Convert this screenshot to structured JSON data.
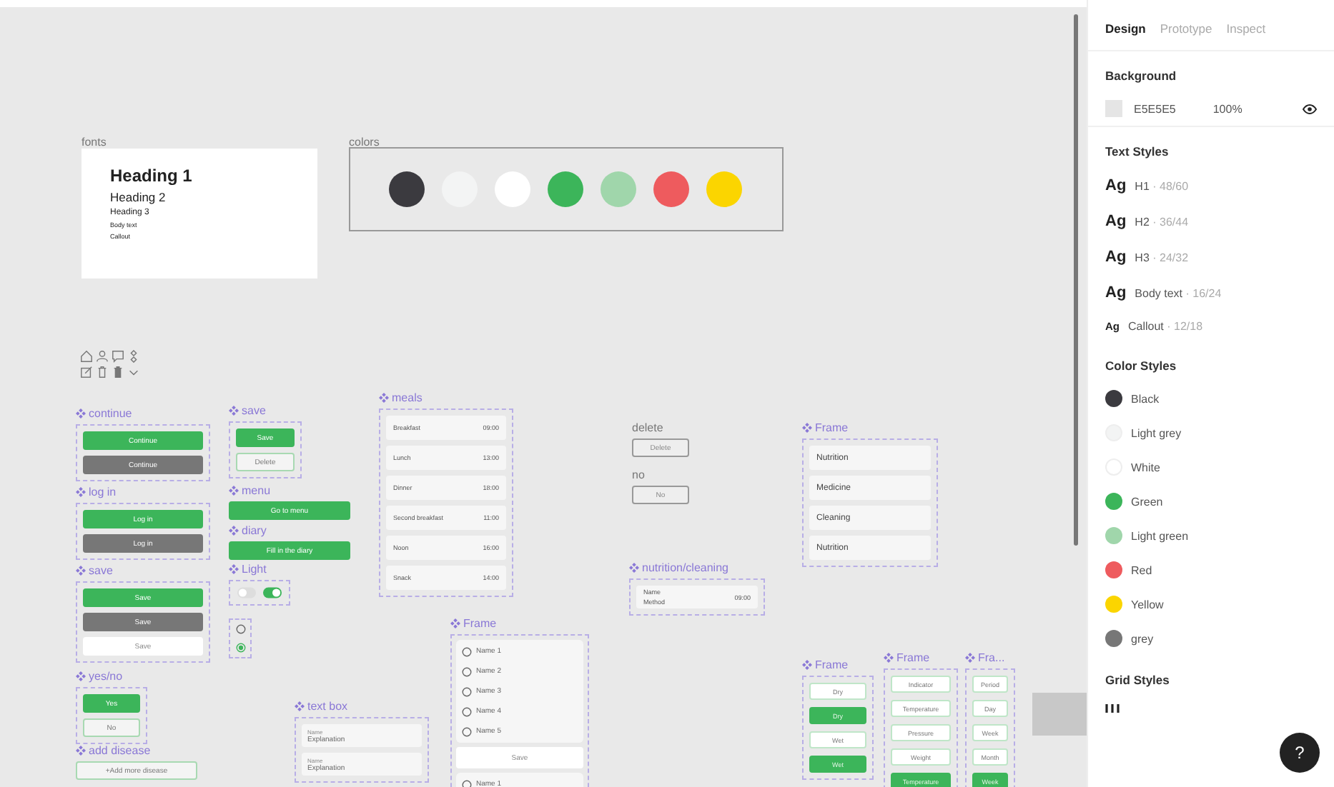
{
  "canvas": {
    "fonts": {
      "label": "fonts",
      "samples": [
        "Heading 1",
        "Heading 2",
        "Heading 3",
        "Body text",
        "Callout"
      ]
    },
    "colors": {
      "label": "colors",
      "swatches": [
        {
          "color": "#3b3a3f"
        },
        {
          "color": "#f3f4f4"
        },
        {
          "color": "#ffffff"
        },
        {
          "color": "#3cb55a"
        },
        {
          "color": "#a0d6ab"
        },
        {
          "color": "#ee5b5e"
        },
        {
          "color": "#fbd500"
        }
      ]
    },
    "components": [
      {
        "kind": "buttons",
        "title": "continue",
        "component": true,
        "framed": true,
        "buttons": [
          {
            "label": "Continue",
            "kind": "green"
          },
          {
            "label": "Continue",
            "kind": "grey"
          }
        ]
      },
      {
        "kind": "buttons",
        "title": "log in",
        "component": true,
        "framed": true,
        "buttons": [
          {
            "label": "Log in",
            "kind": "green"
          },
          {
            "label": "Log in",
            "kind": "grey"
          }
        ]
      },
      {
        "kind": "buttons",
        "title": "save",
        "component": true,
        "framed": true,
        "buttons": [
          {
            "label": "Save",
            "kind": "green"
          },
          {
            "label": "Save",
            "kind": "grey"
          },
          {
            "label": "Save",
            "kind": "white"
          }
        ]
      },
      {
        "kind": "buttons",
        "title": "yes/no",
        "component": true,
        "framed": true,
        "buttons": [
          {
            "label": "Yes",
            "kind": "green"
          },
          {
            "label": "No",
            "kind": "outline"
          }
        ]
      },
      {
        "kind": "buttons",
        "title": "add disease",
        "component": true,
        "framed": false,
        "buttons": [
          {
            "label": "+Add more disease",
            "kind": "outline"
          }
        ]
      },
      {
        "kind": "buttons",
        "title": "save",
        "component": true,
        "framed": true,
        "buttons": [
          {
            "label": "Save",
            "kind": "green"
          },
          {
            "label": "Delete",
            "kind": "outline"
          }
        ]
      },
      {
        "kind": "buttons",
        "title": "menu",
        "component": true,
        "framed": false,
        "buttons": [
          {
            "label": "Go to menu",
            "kind": "green"
          }
        ]
      },
      {
        "kind": "buttons",
        "title": "diary",
        "component": true,
        "framed": false,
        "buttons": [
          {
            "label": "Fill in the diary",
            "kind": "green"
          }
        ]
      },
      {
        "kind": "switches",
        "title": "Light",
        "component": true,
        "switches": [
          {
            "on": false
          },
          {
            "on": true
          }
        ]
      },
      {
        "kind": "radios",
        "radios": [
          {
            "selected": false
          },
          {
            "selected": true
          }
        ]
      },
      {
        "kind": "meals",
        "title": "meals",
        "component": true,
        "rows": [
          {
            "name": "Breakfast",
            "time": "09:00"
          },
          {
            "name": "Lunch",
            "time": "13:00"
          },
          {
            "name": "Dinner",
            "time": "18:00"
          },
          {
            "name": "Second breakfast",
            "time": "11:00"
          },
          {
            "name": "Noon",
            "time": "16:00"
          },
          {
            "name": "Snack",
            "time": "14:00"
          }
        ]
      },
      {
        "kind": "fields",
        "title": "text box",
        "component": true,
        "fields": [
          {
            "label": "Name",
            "value": "Explanation"
          },
          {
            "label": "Name",
            "value": "Explanation"
          }
        ]
      },
      {
        "kind": "radio_list",
        "title": "Frame",
        "component": true,
        "options": [
          {
            "label": "Name 1",
            "selected": false
          },
          {
            "label": "Name 2",
            "selected": false
          },
          {
            "label": "Name 3",
            "selected": false
          },
          {
            "label": "Name 4",
            "selected": false
          },
          {
            "label": "Name 5",
            "selected": false
          }
        ],
        "action": "Save",
        "more_options": [
          {
            "label": "Name 1",
            "selected": false
          }
        ]
      },
      {
        "kind": "buttons",
        "title": "delete",
        "component": false,
        "framed": false,
        "buttons": [
          {
            "label": "Delete",
            "kind": "bordered"
          }
        ]
      },
      {
        "kind": "buttons",
        "title": "no",
        "component": false,
        "framed": false,
        "buttons": [
          {
            "label": "No",
            "kind": "bordered"
          }
        ]
      },
      {
        "kind": "info",
        "title": "nutrition/cleaning",
        "component": true,
        "name": "Name",
        "method": "Method",
        "time": "09:00"
      },
      {
        "kind": "list",
        "title": "Frame",
        "component": true,
        "items": [
          "Nutrition",
          "Medicine",
          "Cleaning",
          "Nutrition"
        ]
      },
      {
        "kind": "chips",
        "title": "Frame",
        "component": true,
        "chips": [
          {
            "label": "Dry",
            "selected": false
          },
          {
            "label": "Dry",
            "selected": true
          },
          {
            "label": "Wet",
            "selected": false
          },
          {
            "label": "Wet",
            "selected": true
          }
        ]
      },
      {
        "kind": "chips",
        "title": "Frame",
        "component": true,
        "chips": [
          {
            "label": "Indicator",
            "selected": false
          },
          {
            "label": "Temperature",
            "selected": false
          },
          {
            "label": "Pressure",
            "selected": false
          },
          {
            "label": "Weight",
            "selected": false
          },
          {
            "label": "Temperature",
            "selected": true
          }
        ]
      },
      {
        "kind": "chips",
        "title": "Fra...",
        "component": true,
        "chips": [
          {
            "label": "Period",
            "selected": false
          },
          {
            "label": "Day",
            "selected": false
          },
          {
            "label": "Week",
            "selected": false
          },
          {
            "label": "Month",
            "selected": false
          },
          {
            "label": "Week",
            "selected": true
          }
        ]
      }
    ]
  },
  "panel": {
    "tabs": [
      {
        "label": "Design",
        "selected": true
      },
      {
        "label": "Prototype",
        "selected": false
      },
      {
        "label": "Inspect",
        "selected": false
      }
    ],
    "background": {
      "title": "Background",
      "hex": "E5E5E5",
      "opacity": "100%"
    },
    "text_styles": {
      "title": "Text Styles",
      "items": [
        {
          "sample": "Ag",
          "name": "H1",
          "spec": " · 48/60",
          "kind": "large"
        },
        {
          "sample": "Ag",
          "name": "H2",
          "spec": " · 36/44",
          "kind": "large"
        },
        {
          "sample": "Ag",
          "name": "H3",
          "spec": " · 24/32",
          "kind": "large"
        },
        {
          "sample": "Ag",
          "name": "Body text",
          "spec": " · 16/24",
          "kind": "large"
        },
        {
          "sample": "Ag",
          "name": "Callout",
          "spec": " · 12/18",
          "kind": "small"
        }
      ]
    },
    "color_styles": {
      "title": "Color Styles",
      "items": [
        {
          "name": "Black",
          "color": "#3b3a3f"
        },
        {
          "name": "Light grey",
          "color": "#f3f4f4"
        },
        {
          "name": "White",
          "color": "#ffffff"
        },
        {
          "name": "Green",
          "color": "#3cb55a"
        },
        {
          "name": "Light green",
          "color": "#a0d6ab"
        },
        {
          "name": "Red",
          "color": "#ee5b5e"
        },
        {
          "name": "Yellow",
          "color": "#fbd500"
        },
        {
          "name": "grey",
          "color": "#777777"
        }
      ]
    },
    "grid_styles": {
      "title": "Grid Styles"
    },
    "help": "?"
  }
}
